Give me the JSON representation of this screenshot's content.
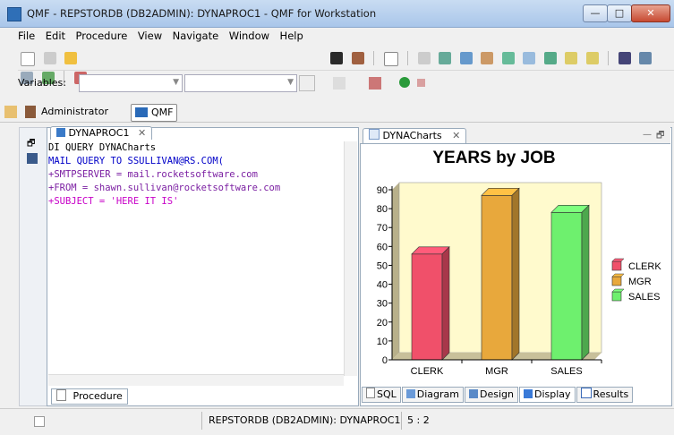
{
  "window": {
    "title": "QMF - REPSTORDB (DB2ADMIN): DYNAPROC1 - QMF for Workstation",
    "minimize": "—",
    "maximize": "□",
    "close": "✕"
  },
  "menu": {
    "items": [
      "File",
      "Edit",
      "Procedure",
      "View",
      "Navigate",
      "Window",
      "Help"
    ]
  },
  "toolbar2": {
    "variables_label": "Variables:"
  },
  "perspectives": {
    "administrator": "Administrator",
    "qmf": "QMF"
  },
  "editor": {
    "tab_label": "DYNAPROC1",
    "tab_close": "✕",
    "lines": [
      "DI QUERY DYNACharts",
      "MAIL QUERY TO SSULLIVAN@RS.COM(",
      "+SMTPSERVER = mail.rocketsoftware.com",
      "+FROM = shawn.sullivan@rocketsoftware.com",
      "+SUBJECT = 'HERE IT IS'"
    ],
    "bottom_tab": "Procedure"
  },
  "chart_panel": {
    "tab_label": "DYNACharts",
    "tab_close": "✕",
    "bottom_tabs": [
      "SQL",
      "Diagram",
      "Design",
      "Display",
      "Results"
    ]
  },
  "chart_data": {
    "type": "bar",
    "title": "YEARS by JOB",
    "categories": [
      "CLERK",
      "MGR",
      "SALES"
    ],
    "values": [
      56,
      87,
      78
    ],
    "ylim": [
      0,
      90
    ],
    "yticks": [
      0,
      10,
      20,
      30,
      40,
      50,
      60,
      70,
      80,
      90
    ],
    "legend": [
      "CLERK",
      "MGR",
      "SALES"
    ],
    "legend_position": "right",
    "colors": [
      "#f0506a",
      "#e8a83c",
      "#6ef06e"
    ],
    "grid": false
  },
  "status": {
    "connection": "REPSTORDB (DB2ADMIN): DYNAPROC1",
    "position": "5 : 2"
  },
  "colors": {
    "titlebar": "#bcd3ef",
    "chart_bg": "#fffacd"
  }
}
